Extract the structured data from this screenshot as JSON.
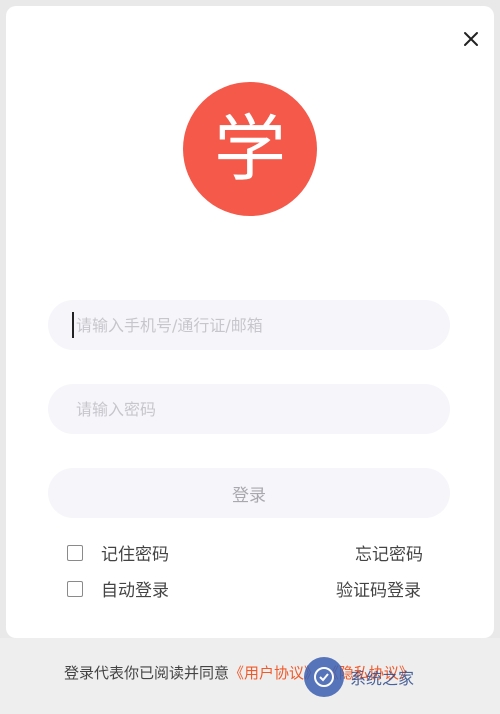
{
  "window": {
    "close_icon": "close-icon"
  },
  "logo": {
    "text": "学",
    "color": "#f4594a"
  },
  "form": {
    "account_placeholder": "请输入手机号/通行证/邮箱",
    "password_placeholder": "请输入密码",
    "login_label": "登录"
  },
  "options": {
    "remember_password": "记住密码",
    "auto_login": "自动登录",
    "forgot_password": "忘记密码",
    "sms_login": "验证码登录"
  },
  "footer": {
    "agreement_prefix": "登录代表你已阅读并同意",
    "user_agreement": "《用户协议》",
    "privacy_policy": "《隐私协议》",
    "link_color": "#f05a2a"
  },
  "watermark": {
    "text": "系统之家",
    "icon": "watermark-logo-icon"
  }
}
